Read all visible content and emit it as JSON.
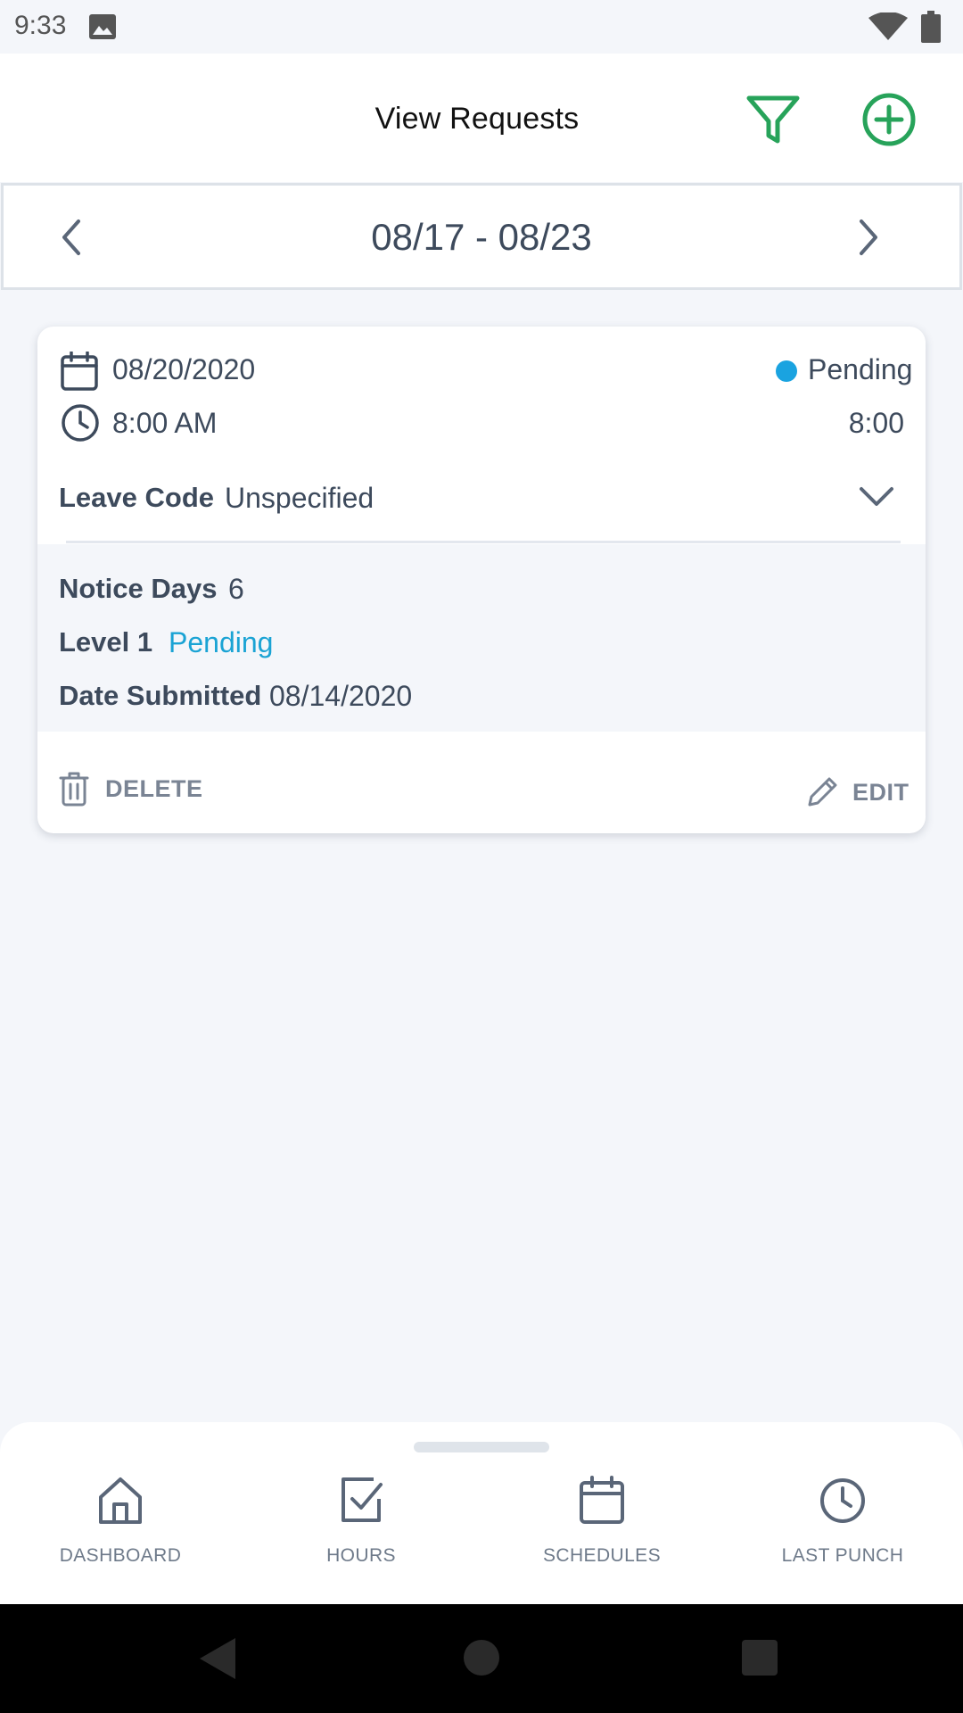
{
  "status_bar": {
    "time": "9:33",
    "icons": [
      "image-icon",
      "wifi-icon",
      "battery-icon"
    ]
  },
  "header": {
    "title": "View Requests",
    "actions": [
      "filter-icon",
      "add-circle-icon"
    ],
    "accent_color": "#27a35a"
  },
  "week_nav": {
    "range": "08/17 - 08/23"
  },
  "request": {
    "date": "08/20/2020",
    "start_time": "8:00 AM",
    "status": "Pending",
    "status_color": "#1aa3e0",
    "duration": "8:00",
    "leave_code_label": "Leave Code",
    "leave_code_value": "Unspecified",
    "details": {
      "notice_days_label": "Notice Days",
      "notice_days_value": "6",
      "level_label": "Level 1",
      "level_value": "Pending",
      "submitted_label": "Date Submitted",
      "submitted_value": "08/14/2020"
    },
    "actions": {
      "delete_label": "DELETE",
      "edit_label": "EDIT"
    }
  },
  "bottom_nav": {
    "items": [
      {
        "label": "DASHBOARD",
        "icon": "home-icon"
      },
      {
        "label": "HOURS",
        "icon": "checkbox-icon"
      },
      {
        "label": "SCHEDULES",
        "icon": "calendar-icon"
      },
      {
        "label": "LAST PUNCH",
        "icon": "clock-icon"
      }
    ]
  },
  "system_nav": {
    "buttons": [
      "back-icon",
      "home-circle-icon",
      "recents-square-icon"
    ]
  }
}
